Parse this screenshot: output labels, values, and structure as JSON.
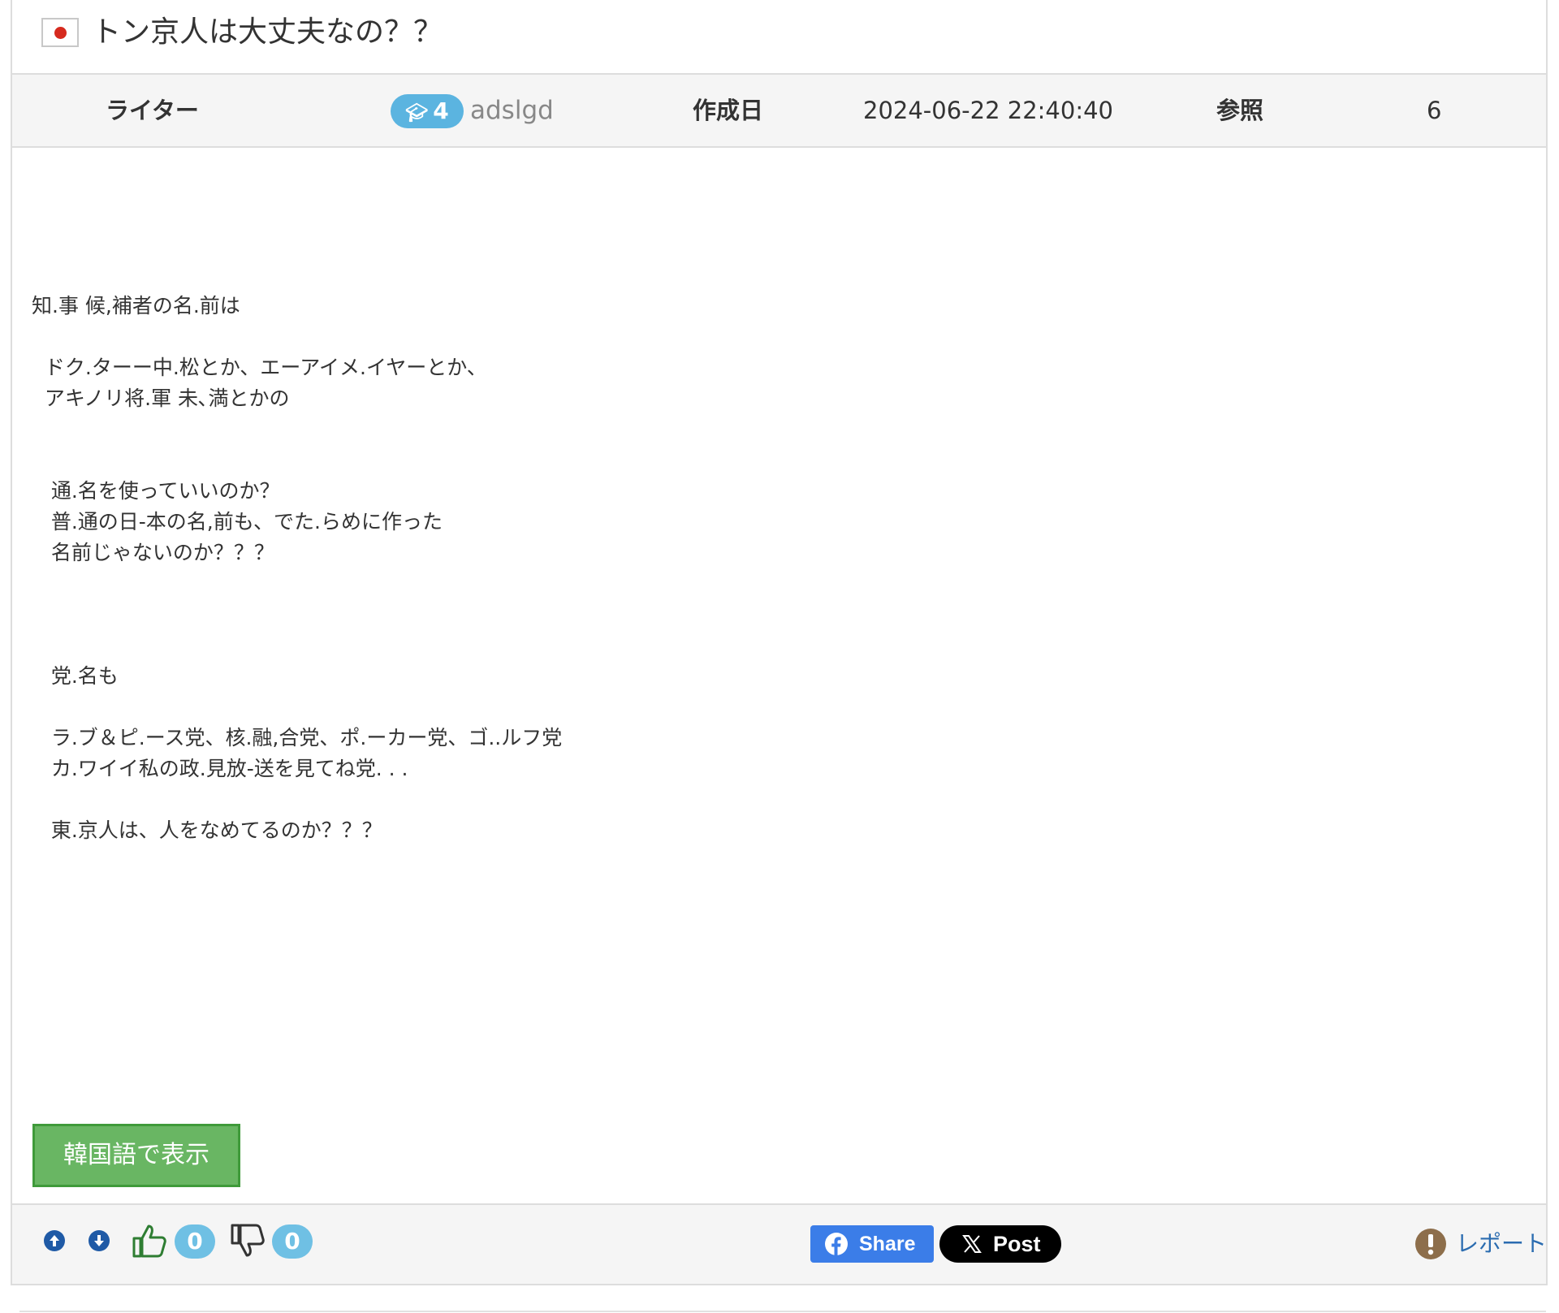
{
  "post": {
    "flag": "japan-flag",
    "title": "トン京人は大丈夫なの？？"
  },
  "meta": {
    "writer_label": "ライター",
    "level": "4",
    "author": "adslgd",
    "date_label": "作成日",
    "date_value": "2024-06-22 22:40:40",
    "views_label": "参照",
    "views_value": "6"
  },
  "body": {
    "lines": [
      "知.事 候,補者の名.前は",
      "",
      "  ドク.ターー中.松とか、エーアイメ.イヤーとか、",
      "  アキノリ将.軍 未､満とかの",
      "",
      "",
      "   通.名を使っていいのか？",
      "   普.通の日-本の名,前も、でた.らめに作った",
      "   名前じゃないのか？？？",
      "",
      "",
      "",
      "   党.名も",
      "",
      "   ラ.ブ＆ピ.ース党、核.融,合党、ポ.ーカー党、ゴ..ルフ党",
      "   カ.ワイイ私の政.見放-送を見てね党. . .",
      "",
      "   東.京人は、人をなめてるのか？？？"
    ],
    "view_korean": "韓国語で表示"
  },
  "footer": {
    "like_count": "0",
    "dislike_count": "0",
    "fb_share": "Share",
    "x_post": "Post",
    "report": "レポート"
  },
  "colors": {
    "badge": "#5bb4e0",
    "korean_button": "#69b663",
    "facebook": "#3b7de8",
    "report_link": "#2b6cb0",
    "vote_icon": "#1f5aa6"
  }
}
